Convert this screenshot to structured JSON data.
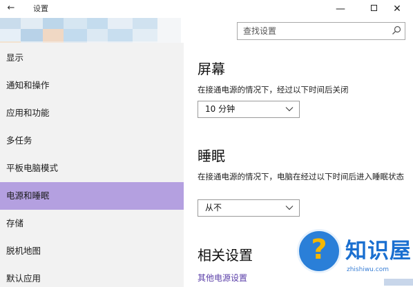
{
  "titlebar": {
    "back_glyph": "←",
    "app_title": "设置",
    "minimize_glyph": "—",
    "close_glyph": "✕"
  },
  "search": {
    "placeholder": "查找设置"
  },
  "sidebar": {
    "items": [
      {
        "label": "显示",
        "active": false
      },
      {
        "label": "通知和操作",
        "active": false
      },
      {
        "label": "应用和功能",
        "active": false
      },
      {
        "label": "多任务",
        "active": false
      },
      {
        "label": "平板电脑模式",
        "active": false
      },
      {
        "label": "电源和睡眠",
        "active": true
      },
      {
        "label": "存储",
        "active": false
      },
      {
        "label": "脱机地图",
        "active": false
      },
      {
        "label": "默认应用",
        "active": false
      }
    ]
  },
  "main": {
    "screen": {
      "title": "屏幕",
      "description": "在接通电源的情况下，经过以下时间后关闭",
      "selected": "10 分钟"
    },
    "sleep": {
      "title": "睡眠",
      "description": "在接通电源的情况下，电脑在经过以下时间后进入睡眠状态",
      "selected": "从不"
    },
    "related": {
      "title": "相关设置",
      "link": "其他电源设置"
    }
  },
  "watermark": {
    "symbol": "?",
    "title": "知识屋",
    "domain": "zhishiwu.com"
  },
  "colors": {
    "active_item": "#b4a0e0",
    "sidebar_bg": "#f2f2f2",
    "link": "#5a3ea8",
    "watermark_blue": "#1a6fd0"
  },
  "icons": {
    "back": "back-arrow-icon",
    "search": "search-icon",
    "dropdown": "chevron-down-icon"
  }
}
